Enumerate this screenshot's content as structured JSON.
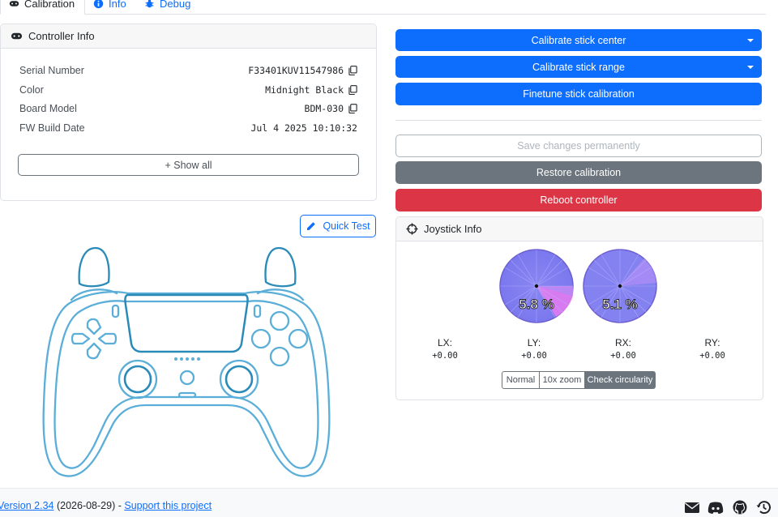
{
  "tabs": [
    {
      "label": "Calibration",
      "icon": "gamepad-icon",
      "active": true
    },
    {
      "label": "Info",
      "icon": "info-icon",
      "active": false
    },
    {
      "label": "Debug",
      "icon": "bug-icon",
      "active": false
    }
  ],
  "controller_info": {
    "title": "Controller Info",
    "rows": [
      {
        "label": "Serial Number",
        "value": "F33401KUV11547986"
      },
      {
        "label": "Color",
        "value": "Midnight Black"
      },
      {
        "label": "Board Model",
        "value": "BDM-030"
      },
      {
        "label": "FW Build Date",
        "value": "Jul 4 2025 10:10:32"
      }
    ],
    "show_all_label": "+ Show all"
  },
  "quick_test_label": "Quick Test",
  "actions": {
    "calibrate_center": "Calibrate stick center",
    "calibrate_range": "Calibrate stick range",
    "finetune": "Finetune stick calibration",
    "save": "Save changes permanently",
    "restore": "Restore calibration",
    "reboot": "Reboot controller"
  },
  "joystick": {
    "title": "Joystick Info",
    "left_pct": "5.8 %",
    "right_pct": "5.1 %",
    "axes": [
      {
        "label": "LX:",
        "value": "+0.00"
      },
      {
        "label": "LY:",
        "value": "+0.00"
      },
      {
        "label": "RX:",
        "value": "+0.00"
      },
      {
        "label": "RY:",
        "value": "+0.00"
      }
    ],
    "modes": [
      "Normal",
      "10x zoom",
      "Check circularity"
    ],
    "active_mode": "Check circularity"
  },
  "footer": {
    "version_link": "Version 2.34",
    "date": " (2026-08-29) - ",
    "support_link": "Support this project",
    "icons": [
      "envelope-icon",
      "discord-icon",
      "github-icon",
      "history-icon"
    ]
  },
  "colors": {
    "primary": "#0d6efd",
    "secondary": "#6c757d",
    "danger": "#dc3545",
    "controller_stroke": "#5aaed8",
    "controller_accent": "#2a8ab8"
  }
}
